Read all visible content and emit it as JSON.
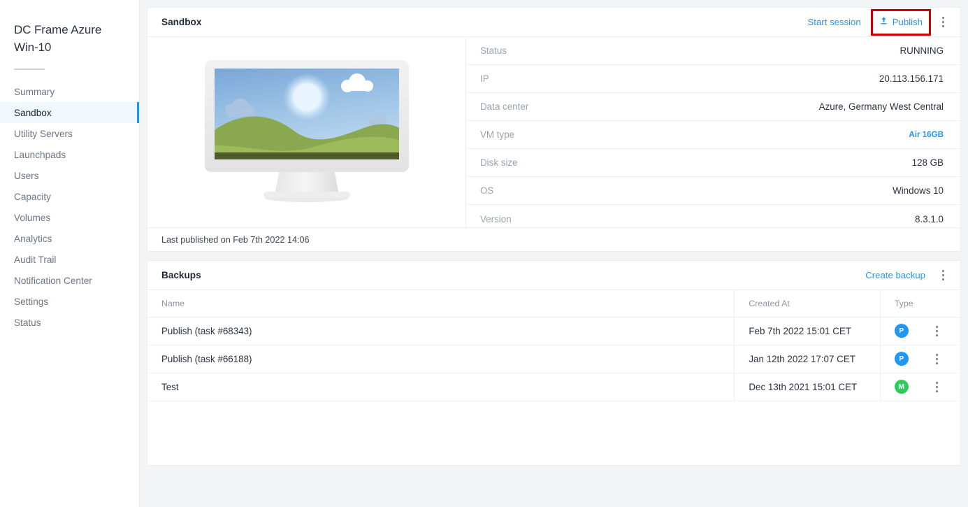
{
  "sidebar": {
    "title": "DC Frame Azure Win-10",
    "items": [
      {
        "label": "Summary",
        "active": false
      },
      {
        "label": "Sandbox",
        "active": true
      },
      {
        "label": "Utility Servers",
        "active": false
      },
      {
        "label": "Launchpads",
        "active": false
      },
      {
        "label": "Users",
        "active": false
      },
      {
        "label": "Capacity",
        "active": false
      },
      {
        "label": "Volumes",
        "active": false
      },
      {
        "label": "Analytics",
        "active": false
      },
      {
        "label": "Audit Trail",
        "active": false
      },
      {
        "label": "Notification Center",
        "active": false
      },
      {
        "label": "Settings",
        "active": false
      },
      {
        "label": "Status",
        "active": false
      }
    ]
  },
  "sandbox": {
    "title": "Sandbox",
    "start_session_label": "Start session",
    "publish_label": "Publish",
    "publish_icon": "upload-icon",
    "publish_highlight_color": "#cc0000",
    "menu_icon": "kebab-menu-icon",
    "illustration": "desktop-monitor-wallpaper-illustration",
    "specs": [
      {
        "key": "Status",
        "value": "RUNNING",
        "link": false
      },
      {
        "key": "IP",
        "value": "20.113.156.171",
        "link": false
      },
      {
        "key": "Data center",
        "value": "Azure, Germany West Central",
        "link": false
      },
      {
        "key": "VM type",
        "value": "Air 16GB",
        "link": true
      },
      {
        "key": "Disk size",
        "value": "128 GB",
        "link": false
      },
      {
        "key": "OS",
        "value": "Windows 10",
        "link": false
      },
      {
        "key": "Version",
        "value": "8.3.1.0",
        "link": false
      }
    ],
    "footer": "Last published on Feb 7th 2022 14:06"
  },
  "backups": {
    "title": "Backups",
    "create_label": "Create backup",
    "menu_icon": "kebab-menu-icon",
    "columns": [
      "Name",
      "Created At",
      "Type"
    ],
    "rows": [
      {
        "name": "Publish (task #68343)",
        "created_at": "Feb 7th 2022 15:01 CET",
        "type": "P",
        "type_color": "#2196f3"
      },
      {
        "name": "Publish (task #66188)",
        "created_at": "Jan 12th 2022 17:07 CET",
        "type": "P",
        "type_color": "#2196f3"
      },
      {
        "name": "Test",
        "created_at": "Dec 13th 2021 15:01 CET",
        "type": "M",
        "type_color": "#2ecc5e"
      }
    ]
  },
  "theme": {
    "accent": "#2196f3",
    "page_bg": "#f3f4f6",
    "active_nav_bg": "#f0f8fd"
  }
}
